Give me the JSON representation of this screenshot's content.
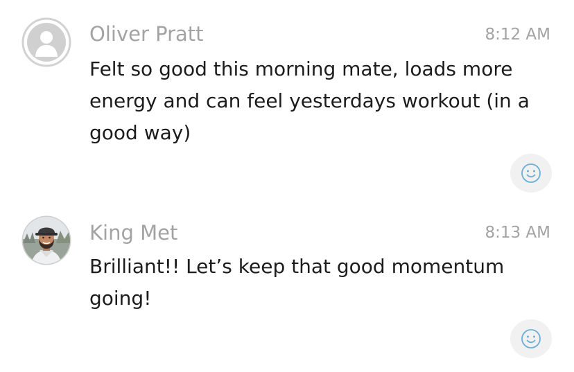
{
  "messages": [
    {
      "sender": "Oliver Pratt",
      "time": "8:12 AM",
      "text": "Felt so good this morning mate, loads more energy and can feel yesterdays workout (in a good way)",
      "avatar": "default-user-silhouette-icon",
      "reaction_icon": "smiley-face-icon"
    },
    {
      "sender": "King Met",
      "time": "8:13 AM",
      "text": "Brilliant!! Let’s keep that good momentum going!",
      "avatar": "user-profile-photo",
      "reaction_icon": "smiley-face-icon"
    }
  ],
  "colors": {
    "meta_text": "#a3a3a3",
    "body_text": "#1c1c1c",
    "reaction_bg": "#f1f1f1",
    "reaction_icon": "#6aaed6",
    "placeholder_avatar": "#d0d0d0"
  }
}
